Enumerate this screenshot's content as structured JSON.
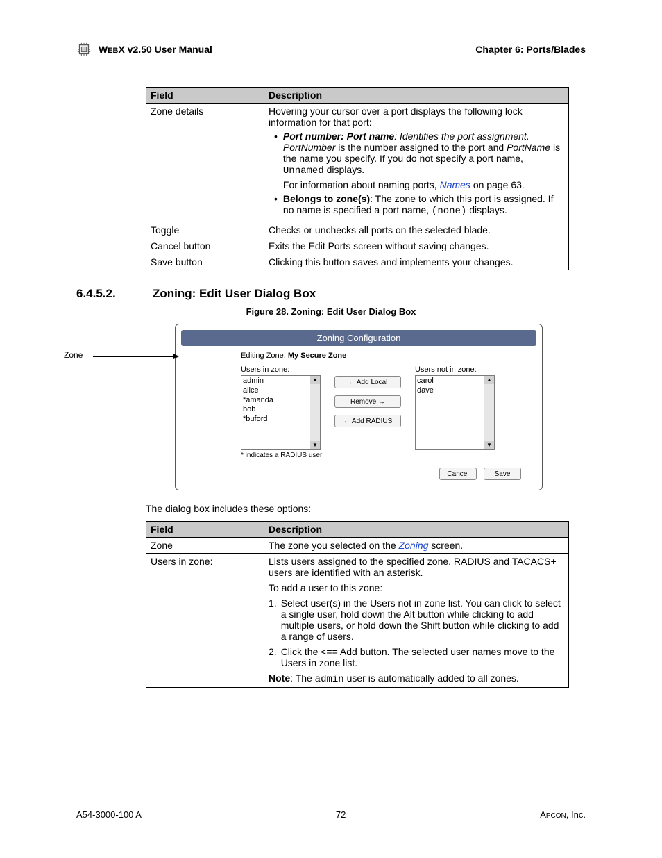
{
  "header": {
    "manual_prefix": "W",
    "manual_mid": "EB",
    "manual_suffix": "X v2.50 User Manual",
    "chapter": "Chapter 6: Ports/Blades"
  },
  "table1": {
    "col_field": "Field",
    "col_desc": "Description",
    "r1_field": "Zone details",
    "r1_intro": "Hovering your cursor over a port displays the following lock information for that port:",
    "r1_b1_lead_bold": "Port number: Port name",
    "r1_b1_lead_tail": ": Identifies the port assignment. ",
    "r1_b1_pn_italic": "PortNumber",
    "r1_b1_mid": " is the number assigned to the port and ",
    "r1_b1_pname_italic": "PortName",
    "r1_b1_tail": " is the name you specify. If you do not specify a port name, ",
    "r1_b1_unnamed": "Unnamed",
    "r1_b1_after": " displays.",
    "r1_info": "For information about naming ports, ",
    "r1_info_link": "Names",
    "r1_info_tail": " on page 63.",
    "r1_b2_bold": "Belongs to zone(s)",
    "r1_b2_tail": ": The zone to which this port is assigned. If no name is specified a port name, ",
    "r1_b2_none": "(none)",
    "r1_b2_after": " displays.",
    "r2_field": "Toggle",
    "r2_desc": "Checks or unchecks all ports on the selected blade.",
    "r3_field": "Cancel button",
    "r3_desc": "Exits the Edit Ports screen without saving changes.",
    "r4_field": "Save button",
    "r4_desc": "Clicking this button saves and implements your changes."
  },
  "section": {
    "num": "6.4.5.2.",
    "title": "Zoning: Edit User Dialog Box",
    "figcap": "Figure 28. Zoning: Edit User Dialog Box"
  },
  "dialog": {
    "callout": "Zone",
    "titlebar": "Zoning Configuration",
    "editing_label": "Editing Zone:",
    "editing_value": "My Secure Zone",
    "users_in_label": "Users in zone:",
    "users_in": [
      "admin",
      "alice",
      "*amanda",
      "bob",
      "*buford"
    ],
    "users_out_label": "Users not in zone:",
    "users_out": [
      "carol",
      "dave"
    ],
    "btn_add_local": "← Add Local",
    "btn_remove": "Remove →",
    "btn_add_radius": "← Add RADIUS",
    "radius_note": "* indicates a RADIUS user",
    "btn_cancel": "Cancel",
    "btn_save": "Save"
  },
  "para1": "The dialog box includes these options:",
  "table2": {
    "col_field": "Field",
    "col_desc": "Description",
    "r1_field": "Zone",
    "r1_desc_a": "The zone you selected on the ",
    "r1_link": "Zoning",
    "r1_desc_b": " screen.",
    "r2_field": "Users in zone:",
    "r2_p1": "Lists users assigned to the specified zone. RADIUS and TACACS+ users are identified with an asterisk.",
    "r2_p2": "To add a user to this zone:",
    "r2_step1": "Select user(s) in the Users not in zone list. You can click to select a single user, hold down the Alt button while clicking to add multiple users, or hold down the Shift button while clicking to add a range of users.",
    "r2_step2a": "Click the <== Add button. The selected user names move to the Users in zone list.",
    "r2_note_lead": "Note",
    "r2_note_mid": ": The ",
    "r2_note_code": "admin",
    "r2_note_tail": " user is automatically added to all zones."
  },
  "footer": {
    "left": "A54-3000-100 A",
    "center": "72",
    "right_a": "A",
    "right_b": "PCON",
    "right_c": ", Inc."
  }
}
